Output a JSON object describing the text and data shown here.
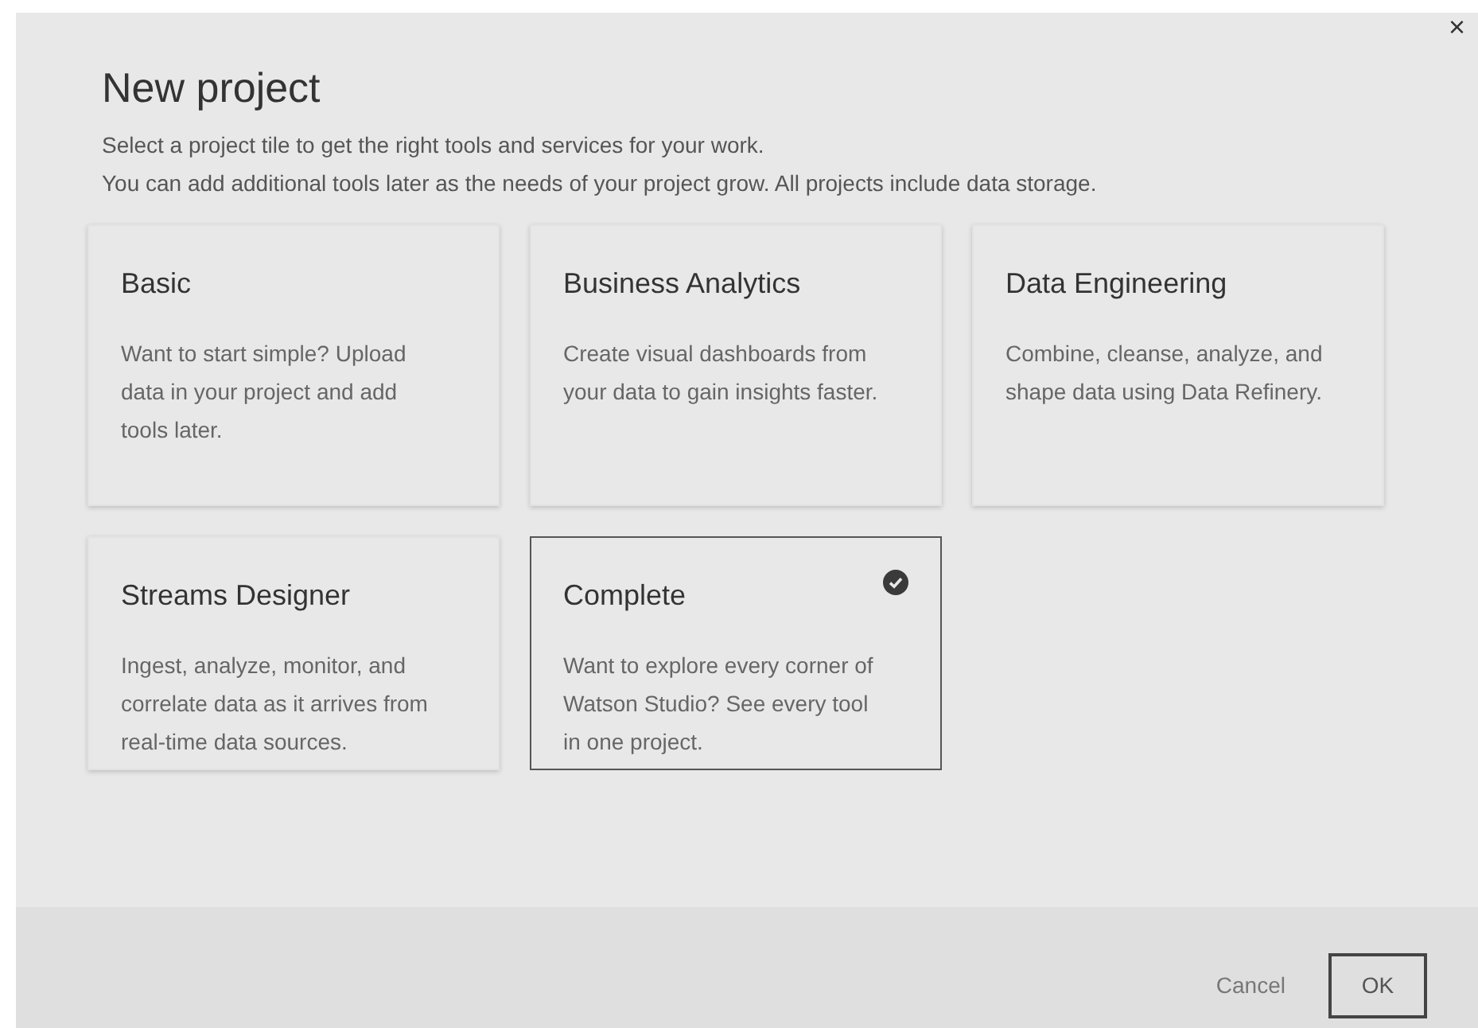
{
  "dialog": {
    "title": "New project",
    "close": "×",
    "intro": [
      "Select a project tile to get the right tools and services for your work.",
      "You can add additional tools later as the needs of your project grow. All projects include data storage."
    ]
  },
  "tiles": [
    {
      "title": "Basic",
      "description": "Want to start simple? Upload data in your project and add tools later.",
      "selected": false
    },
    {
      "title": "Business Analytics",
      "description": "Create visual dashboards from your data to gain insights faster.",
      "selected": false
    },
    {
      "title": "Data Engineering",
      "description": "Combine, cleanse, analyze, and shape data using Data Refinery.",
      "selected": false
    },
    {
      "title": "Streams Designer",
      "description": "Ingest, analyze, monitor, and correlate data as it arrives from real-time data sources.",
      "selected": false
    },
    {
      "title": "Complete",
      "description": "Want to explore every corner of Watson Studio? See every tool in one project.",
      "selected": true
    }
  ],
  "buttons": {
    "cancel": "Cancel",
    "ok": "OK"
  }
}
